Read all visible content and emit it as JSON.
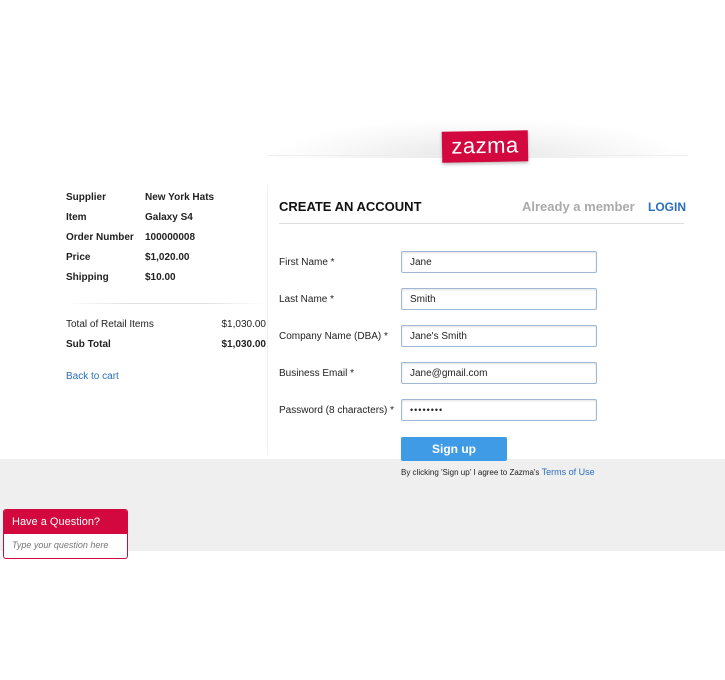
{
  "brand": {
    "logo_text": "zazma",
    "accent": "#d3083e",
    "link_color": "#2a6ebb",
    "button_color": "#3f9be6"
  },
  "order_summary": {
    "rows": [
      {
        "label": "Supplier",
        "value": "New York Hats"
      },
      {
        "label": "Item",
        "value": "Galaxy S4"
      },
      {
        "label": "Order Number",
        "value": "100000008"
      },
      {
        "label": "Price",
        "value": "$1,020.00"
      },
      {
        "label": "Shipping",
        "value": "$10.00"
      }
    ],
    "total_retail_label": "Total of Retail Items",
    "total_retail_value": "$1,030.00",
    "subtotal_label": "Sub Total",
    "subtotal_value": "$1,030.00",
    "back_link": "Back to cart"
  },
  "form": {
    "title": "CREATE AN ACCOUNT",
    "member_text": "Already a member",
    "login_link": "LOGIN",
    "fields": [
      {
        "label": "First Name *",
        "value": "Jane"
      },
      {
        "label": "Last Name *",
        "value": "Smith"
      },
      {
        "label": "Company Name (DBA) *",
        "value": "Jane's Smith"
      },
      {
        "label": "Business Email *",
        "value": "Jane@gmail.com"
      },
      {
        "label": "Password (8 characters) *",
        "value": "••••••••"
      }
    ],
    "submit_label": "Sign up",
    "terms_text": "By clicking 'Sign up' I agree to Zazma's",
    "terms_link": "Terms of Use"
  },
  "question_widget": {
    "title": "Have a Question?",
    "placeholder": "Type your question here"
  }
}
